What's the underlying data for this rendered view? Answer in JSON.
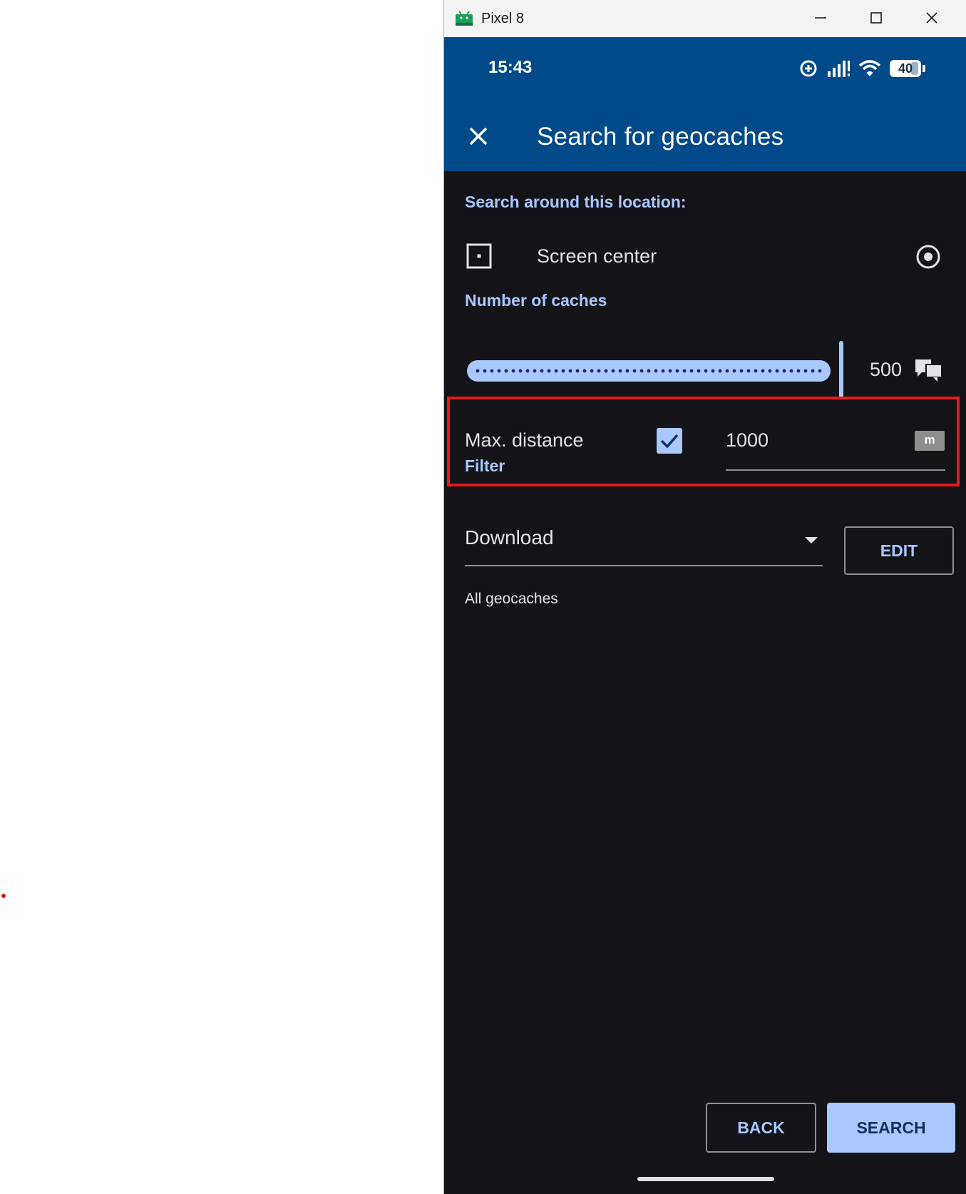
{
  "window": {
    "title": "Pixel 8",
    "app_icon": "android-emulator-icon",
    "controls": [
      "minimize-icon",
      "maximize-icon",
      "close-icon"
    ]
  },
  "status_bar": {
    "time": "15:43",
    "icons": [
      "data-saver-icon",
      "signal-icon",
      "wifi-icon"
    ],
    "battery": "40"
  },
  "app_bar": {
    "title": "Search for geocaches",
    "close_icon": "close-icon"
  },
  "location": {
    "section_label": "Search around this location:",
    "value": "Screen center",
    "icon": "screen-center-icon",
    "action_icon": "my-location-icon"
  },
  "caches": {
    "section_label": "Number of caches",
    "value": "500",
    "slider_fraction": 1.0,
    "icon": "cache-count-icon"
  },
  "distance": {
    "label": "Max. distance",
    "enabled": true,
    "value": "1000",
    "unit": "m"
  },
  "filter": {
    "section_label": "Filter",
    "selected": "Download",
    "edit_label": "EDIT",
    "description": "All geocaches"
  },
  "actions": {
    "back_label": "BACK",
    "search_label": "SEARCH"
  },
  "colors": {
    "app_bar": "#004a89",
    "background": "#131318",
    "accent": "#a8c8ff",
    "highlight": "#e41a1c"
  }
}
